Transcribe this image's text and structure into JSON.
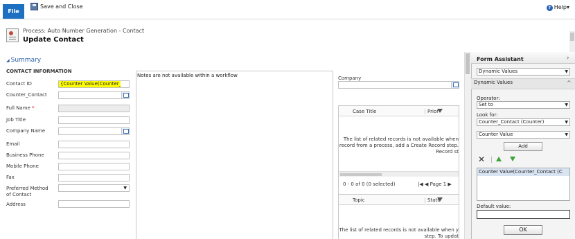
{
  "ribbon": {
    "file_label": "File",
    "save_close_label": "Save and Close",
    "help_label": "Help",
    "help_arrow": "▾"
  },
  "header": {
    "process_title": "Process: Auto Number Generation - Contact",
    "record_title": "Update Contact"
  },
  "summary": {
    "title": "Summary",
    "expand_glyph": "◢",
    "section_title": "CONTACT INFORMATION",
    "fields": {
      "contact_id": {
        "label": "Contact ID",
        "value": "{Counter Value(Counter_"
      },
      "counter_contact": {
        "label": "Counter_Contact"
      },
      "full_name": {
        "label": "Full Name",
        "required_mark": "*"
      },
      "job_title": {
        "label": "Job Title"
      },
      "company_name": {
        "label": "Company Name"
      },
      "email": {
        "label": "Email"
      },
      "business_phone": {
        "label": "Business Phone"
      },
      "mobile_phone": {
        "label": "Mobile Phone"
      },
      "fax": {
        "label": "Fax"
      },
      "preferred_method_1": {
        "label": "Preferred Method"
      },
      "preferred_method_2": {
        "label": "of Contact"
      },
      "preferred_arrow": "▼",
      "address": {
        "label": "Address"
      }
    }
  },
  "notes": {
    "message": "Notes are not available within a workflow"
  },
  "company": {
    "label": "Company"
  },
  "cases_grid": {
    "col1": "Case Title",
    "col2": "Prior",
    "msg_line1": "The list of related records is not available when",
    "msg_line2": "record from a process, add a Create Record step.",
    "msg_line3": "Record st",
    "pager_status": "0 - 0 of 0 (0 selected)",
    "pager_nav": "|◀ ◀ Page 1 ▶"
  },
  "opps_grid": {
    "col1": "Topic",
    "col2": "Statu",
    "msg_line1": "The list of related records is not available when y",
    "msg_line2": "step. To updat"
  },
  "form_assistant": {
    "title": "Form Assistant",
    "chevron": "›",
    "top_select": "Dynamic Values",
    "section_label": "Dynamic Values",
    "section_chevron": "^",
    "operator_label": "Operator:",
    "operator_value": "Set to",
    "look_for_label": "Look for:",
    "look_for_value": "Counter_Contact (Counter)",
    "field_value": "Counter Value",
    "add_label": "Add",
    "delete_glyph": "✕",
    "dynamic_item": "Counter Value(Counter_Contact (C",
    "default_value_label": "Default value:",
    "ok_label": "OK",
    "select_arrow": "▼"
  }
}
